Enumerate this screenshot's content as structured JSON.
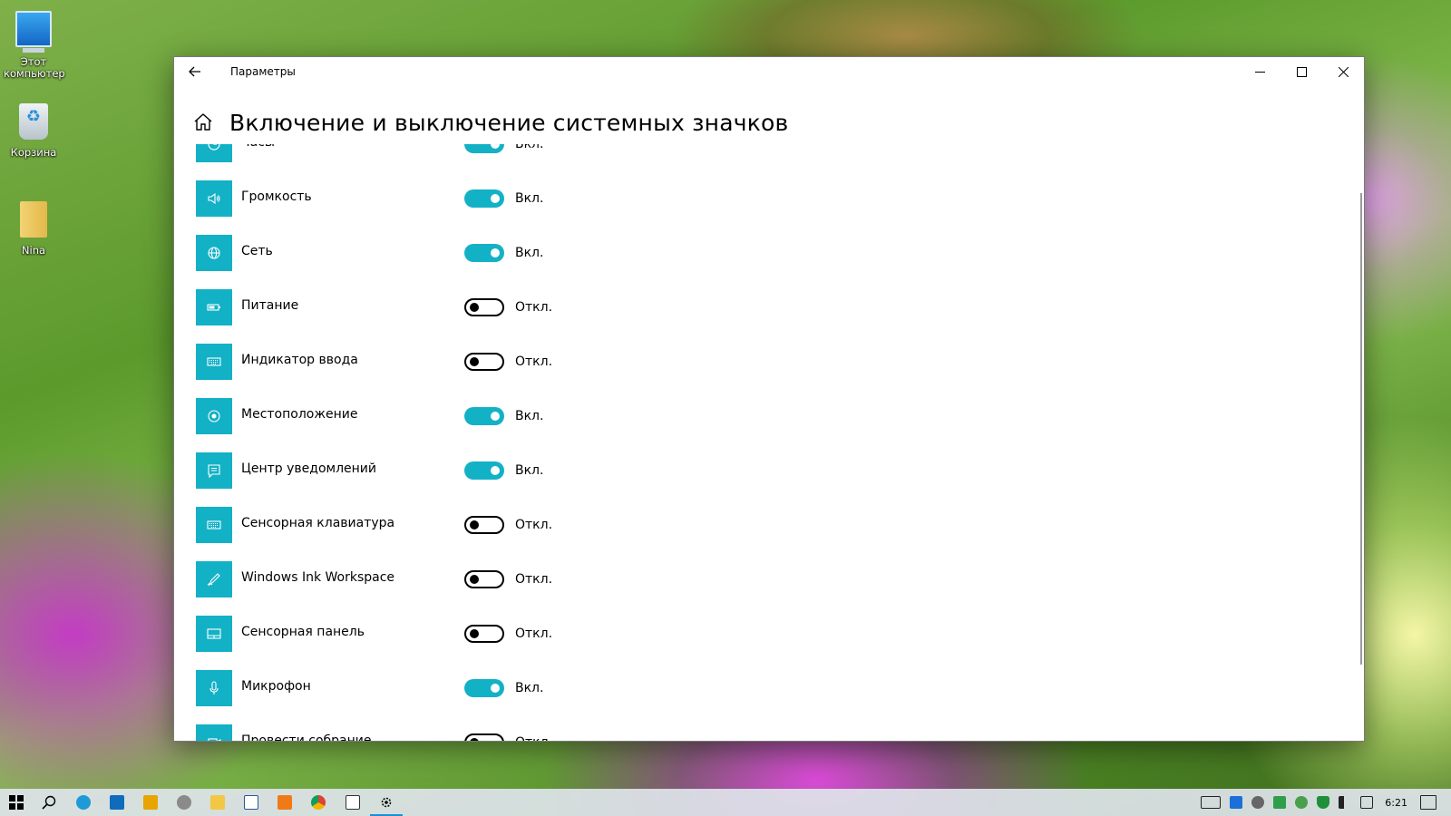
{
  "desktop": {
    "icons": [
      {
        "label_line1": "Этот",
        "label_line2": "компьютер"
      },
      {
        "label_line1": "Корзина"
      },
      {
        "label_line1": "Nina"
      }
    ]
  },
  "window": {
    "title": "Параметры",
    "page_title": "Включение и выключение системных значков"
  },
  "items": [
    {
      "label": "Часы",
      "state": "Вкл.",
      "on": true,
      "icon": "clock-icon"
    },
    {
      "label": "Громкость",
      "state": "Вкл.",
      "on": true,
      "icon": "volume-icon"
    },
    {
      "label": "Сеть",
      "state": "Вкл.",
      "on": true,
      "icon": "globe-icon"
    },
    {
      "label": "Питание",
      "state": "Откл.",
      "on": false,
      "icon": "battery-icon"
    },
    {
      "label": "Индикатор ввода",
      "state": "Откл.",
      "on": false,
      "icon": "keyboard-icon"
    },
    {
      "label": "Местоположение",
      "state": "Вкл.",
      "on": true,
      "icon": "location-icon"
    },
    {
      "label": "Центр уведомлений",
      "state": "Вкл.",
      "on": true,
      "icon": "notification-icon"
    },
    {
      "label": "Сенсорная клавиатура",
      "state": "Откл.",
      "on": false,
      "icon": "touch-keyboard-icon"
    },
    {
      "label": "Windows Ink Workspace",
      "state": "Откл.",
      "on": false,
      "icon": "pen-icon"
    },
    {
      "label": "Сенсорная панель",
      "state": "Откл.",
      "on": false,
      "icon": "touchpad-icon"
    },
    {
      "label": "Микрофон",
      "state": "Вкл.",
      "on": true,
      "icon": "microphone-icon"
    },
    {
      "label": "Провести собрание",
      "state": "Откл.",
      "on": false,
      "icon": "meet-now-icon"
    }
  ],
  "taskbar": {
    "clock": "6:21",
    "apps": [
      "start-icon",
      "search-icon",
      "edge-icon",
      "mail-icon",
      "media-icon",
      "app-icon",
      "explorer-icon",
      "word-icon",
      "office-icon",
      "chrome-icon",
      "app2-icon",
      "settings-icon"
    ]
  },
  "colors": {
    "accent": "#13b1c6"
  }
}
